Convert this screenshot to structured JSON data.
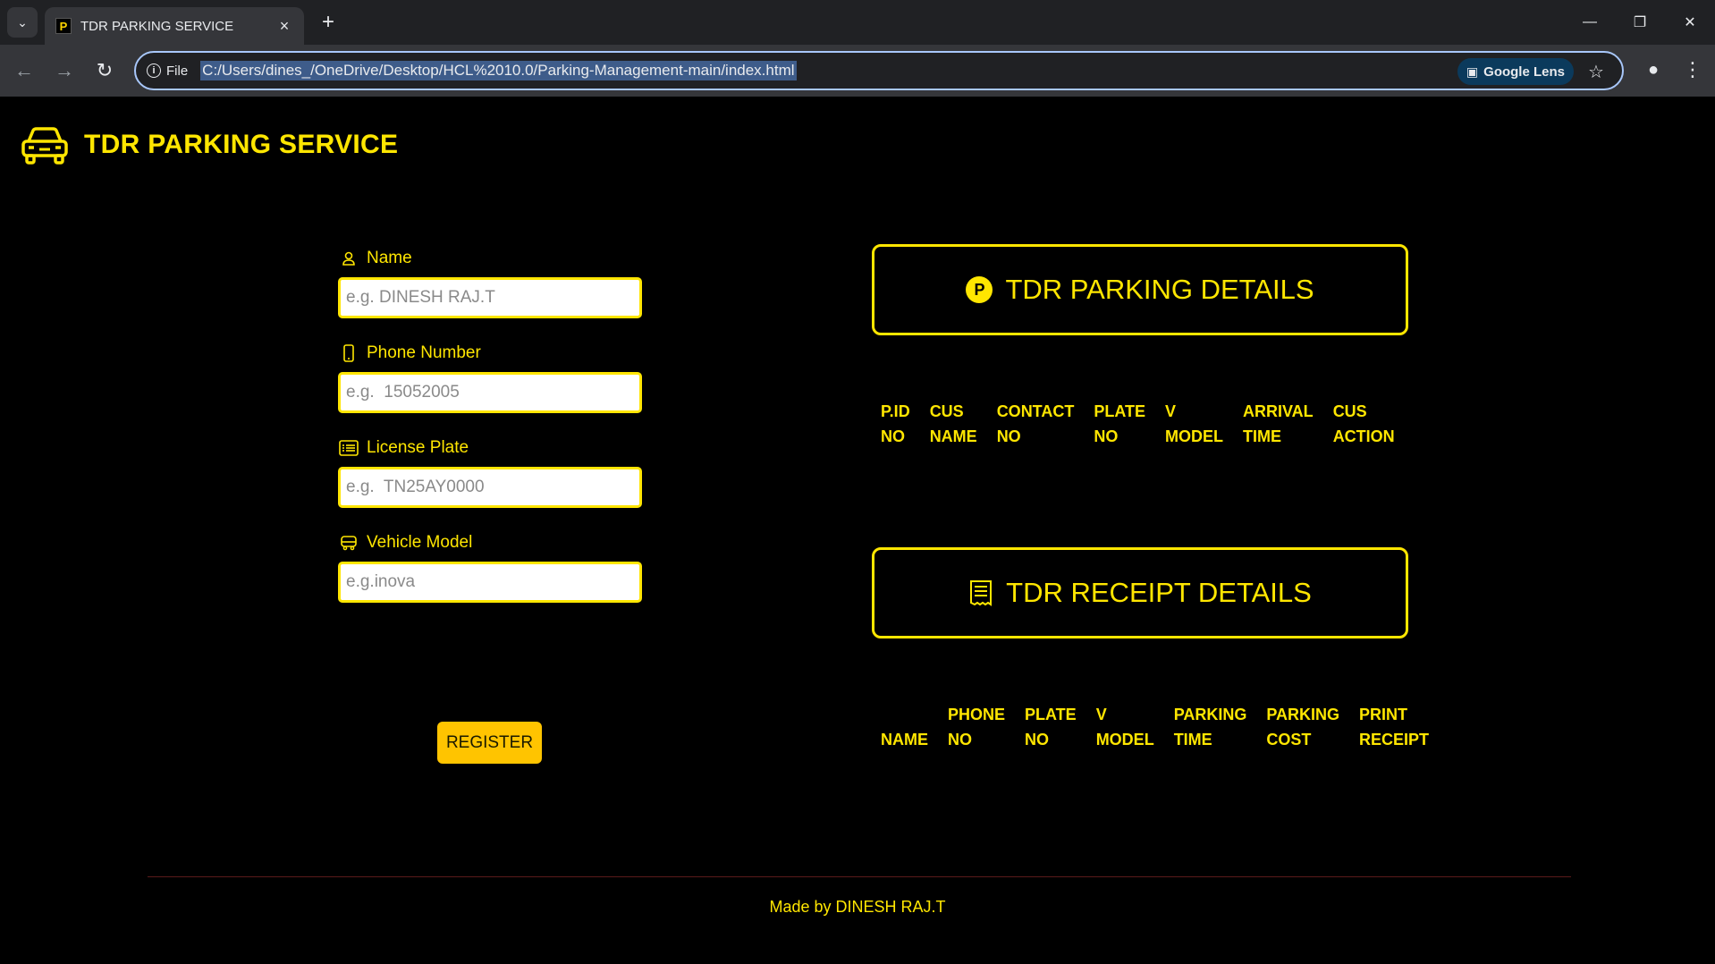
{
  "browser": {
    "tab_title": "TDR PARKING SERVICE",
    "favicon_letter": "P",
    "site_info_label": "File",
    "url": "C:/Users/dines_/OneDrive/Desktop/HCL%2010.0/Parking-Management-main/index.html",
    "lens_label": "Google Lens"
  },
  "header": {
    "title": "TDR PARKING SERVICE"
  },
  "form": {
    "name_label": "Name",
    "name_placeholder": "e.g. DINESH RAJ.T",
    "phone_label": "Phone Number",
    "phone_placeholder": "e.g.  15052005",
    "plate_label": "License Plate",
    "plate_placeholder": "e.g.  TN25AY0000",
    "model_label": "Vehicle Model",
    "model_placeholder": "e.g.inova",
    "register_label": "REGISTER"
  },
  "parking": {
    "title": "TDR PARKING DETAILS",
    "icon_letter": "P",
    "columns": [
      "P.ID\nNO",
      "CUS\nNAME",
      "CONTACT\nNO",
      "PLATE\nNO",
      "V\nMODEL",
      "ARRIVAL\nTIME",
      "CUS\nACTION"
    ]
  },
  "receipt": {
    "title": "TDR RECEIPT DETAILS",
    "columns": [
      "NAME",
      "PHONE\nNO",
      "PLATE\nNO",
      "V\nMODEL",
      "PARKING\nTIME",
      "PARKING\nCOST",
      "PRINT\nRECEIPT"
    ]
  },
  "footer": {
    "text": "Made by DINESH RAJ.T"
  },
  "colors": {
    "accent": "#ffe600",
    "button": "#ffc400",
    "background": "#000000"
  }
}
